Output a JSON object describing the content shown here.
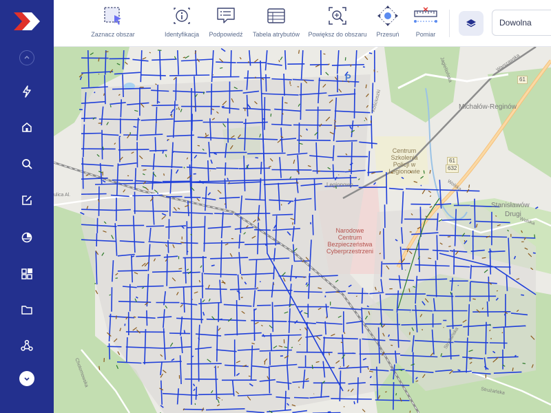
{
  "app": {
    "logo_icon": "brand-chevron-logo",
    "colors": {
      "sidebar": "#23308e",
      "network_blue": "#1f3fd9",
      "network_brown": "#8b5a1b",
      "network_green": "#2d7a2a",
      "map_green": "#c3deb1"
    }
  },
  "sidebar": {
    "items": [
      {
        "name": "collapse-up",
        "icon": "chevron-up-icon"
      },
      {
        "name": "quick-actions",
        "icon": "lightning-icon"
      },
      {
        "name": "home",
        "icon": "home-icon"
      },
      {
        "name": "search",
        "icon": "search-icon"
      },
      {
        "name": "edit",
        "icon": "edit-icon"
      },
      {
        "name": "chart",
        "icon": "pie-chart-icon"
      },
      {
        "name": "modules",
        "icon": "apps-icon"
      },
      {
        "name": "files",
        "icon": "folder-icon"
      },
      {
        "name": "network",
        "icon": "network-icon"
      },
      {
        "name": "expand-down",
        "icon": "chevron-down-icon"
      }
    ]
  },
  "toolbar": {
    "tools": [
      {
        "label": "Zaznacz obszar",
        "icon": "select-area-icon"
      },
      {
        "label": "Identyfikacja",
        "icon": "info-identify-icon"
      },
      {
        "label": "Podpowiedź",
        "icon": "tooltip-hint-icon"
      },
      {
        "label": "Tabela atrybutów",
        "icon": "attribute-table-icon"
      },
      {
        "label": "Powiększ do obszaru",
        "icon": "zoom-to-area-icon"
      },
      {
        "label": "Przesuń",
        "icon": "pan-move-icon"
      },
      {
        "label": "Pomiar",
        "icon": "measure-icon"
      }
    ],
    "layers_icon": "layers-icon",
    "mode_select": {
      "value": "Dowolna"
    }
  },
  "map": {
    "labels": {
      "michalow": "Michałów-Reginów",
      "stanislawow_1": "Stanisławów",
      "stanislawow_2": "Drugi",
      "centrum_1": "Centrum",
      "centrum_2": "Szkolenia",
      "centrum_3": "Policji w",
      "centrum_4": "Legionowie",
      "nccb_1": "Narodowe",
      "nccb_2": "Centrum",
      "nccb_3": "Bezpieczeństwa",
      "nccb_4": "Cyberprzestrzeni",
      "legionowo": "Legionowo",
      "wolska_1": "Wolska",
      "wolska_2": "Wolska",
      "warszawska": "Warszawska",
      "jagiellonska": "Jagiellońska",
      "kosciuszki": "Kościuszki",
      "struzanska_1": "Strużańska",
      "struzanska_2": "Strużańska",
      "chotomowska": "Chotomowska",
      "ulica": "ulica Al.",
      "parking": "P",
      "road_61_a": "61",
      "road_61_b": "61",
      "road_632": "632"
    }
  }
}
